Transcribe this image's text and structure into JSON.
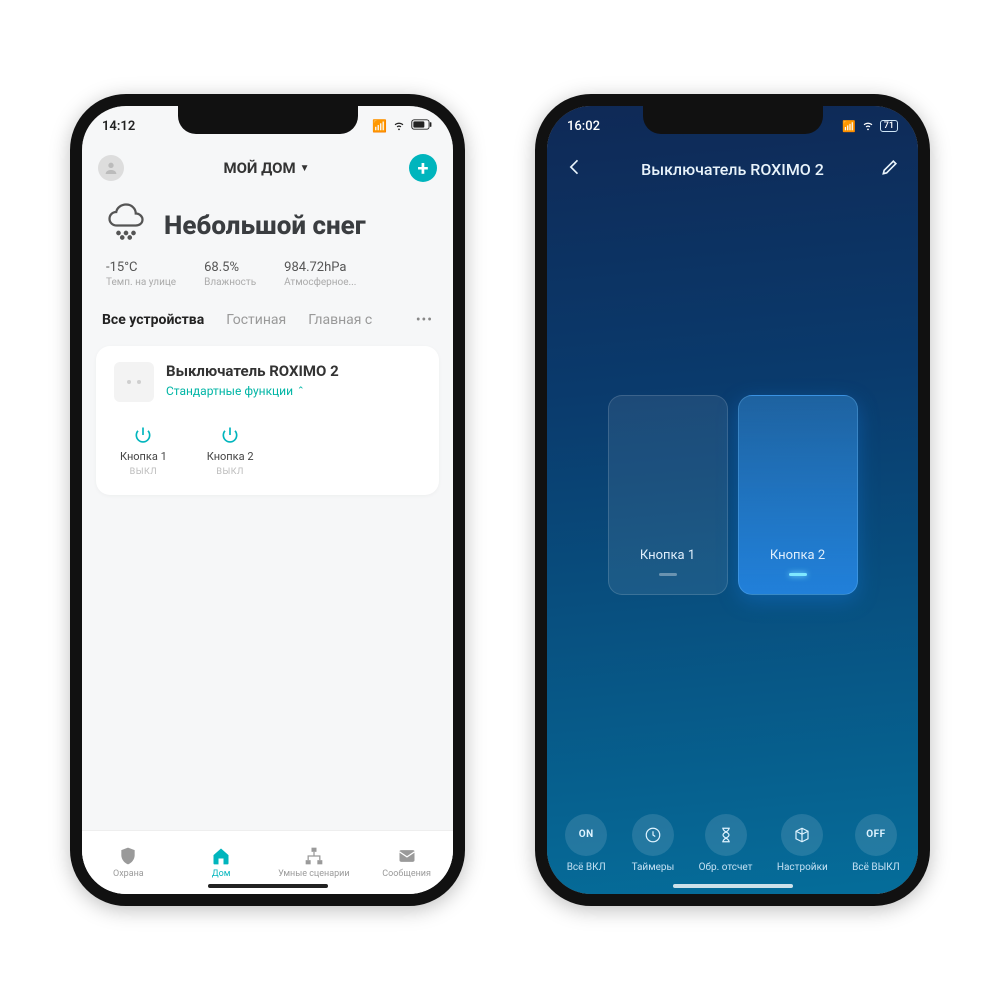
{
  "left": {
    "status_time": "14:12",
    "header_title": "МОЙ ДОМ",
    "weather_title": "Небольшой снег",
    "stats": [
      {
        "value": "-15°C",
        "label": "Темп. на улице"
      },
      {
        "value": "68.5%",
        "label": "Влажность"
      },
      {
        "value": "984.72hPa",
        "label": "Атмосферное..."
      }
    ],
    "tabs": [
      "Все устройства",
      "Гостиная",
      "Главная с"
    ],
    "device": {
      "title": "Выключатель ROXIMO 2",
      "subtitle": "Стандартные функции",
      "buttons": [
        {
          "label": "Кнопка 1",
          "state": "ВЫКЛ"
        },
        {
          "label": "Кнопка 2",
          "state": "ВЫКЛ"
        }
      ]
    },
    "nav": [
      "Охрана",
      "Дом",
      "Умные сценарии",
      "Сообщения"
    ]
  },
  "right": {
    "status_time": "16:02",
    "battery": "71",
    "title": "Выключатель ROXIMO 2",
    "switches": [
      "Кнопка 1",
      "Кнопка 2"
    ],
    "actions": [
      {
        "icon": "ON",
        "label": "Всё ВКЛ"
      },
      {
        "icon": "timer",
        "label": "Таймеры"
      },
      {
        "icon": "hourglass",
        "label": "Обр. отсчет"
      },
      {
        "icon": "cube",
        "label": "Настройки"
      },
      {
        "icon": "OFF",
        "label": "Всё ВЫКЛ"
      }
    ]
  }
}
